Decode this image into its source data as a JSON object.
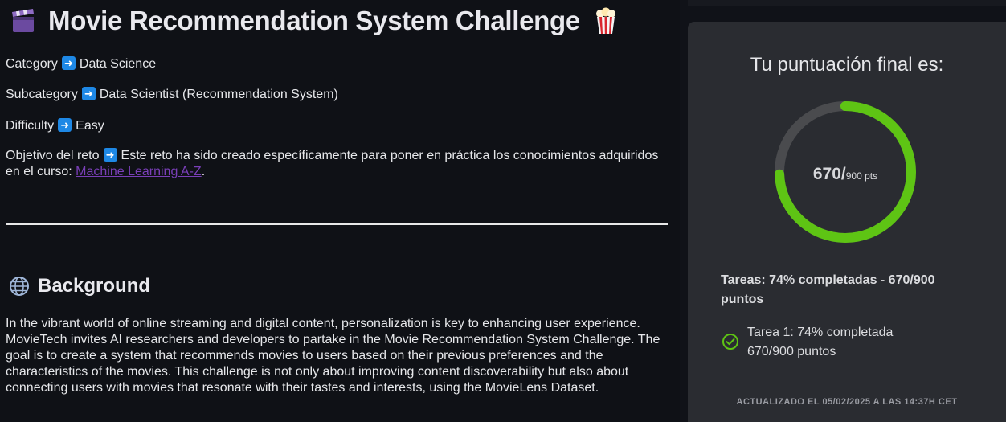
{
  "challenge": {
    "title": "Movie Recommendation System Challenge",
    "title_icon_left": "clapper-board-icon",
    "title_icon_right": "popcorn-icon",
    "category": {
      "label": "Category",
      "value": "Data Science"
    },
    "subcategory": {
      "label": "Subcategory",
      "value": "Data Scientist (Recommendation System)"
    },
    "difficulty": {
      "label": "Difficulty",
      "value": "Easy"
    },
    "objective": {
      "label": "Objetivo del reto",
      "text": "Este reto ha sido creado específicamente para poner en práctica los conocimientos adquiridos en el curso: ",
      "link_text": "Machine Learning A-Z",
      "suffix": "."
    },
    "arrow_icon": "right-arrow-icon"
  },
  "background": {
    "icon": "globe-icon",
    "title": "Background",
    "text": "In the vibrant world of online streaming and digital content, personalization is key to enhancing user experience. MovieTech invites AI researchers and developers to partake in the Movie Recommendation System Challenge. The goal is to create a system that recommends movies to users based on their previous preferences and the characteristics of the movies. This challenge is not only about improving content discoverability but also about connecting users with movies that resonate with their tastes and interests, using the MovieLens Dataset."
  },
  "score": {
    "title": "Tu puntuación final es:",
    "value": "670/",
    "max": "900 pts",
    "fraction": 0.7444,
    "ring_color": "#5ec414",
    "track_color": "#4a4b4e",
    "summary": "Tareas: 74% completadas - 670/900 puntos",
    "tasks": [
      {
        "line1": "Tarea 1: 74% completada",
        "line2": "670/900 puntos",
        "icon": "check-circle-icon"
      }
    ],
    "updated": "ACTUALIZADO EL 05/02/2025 A LAS 14:37H CET"
  }
}
